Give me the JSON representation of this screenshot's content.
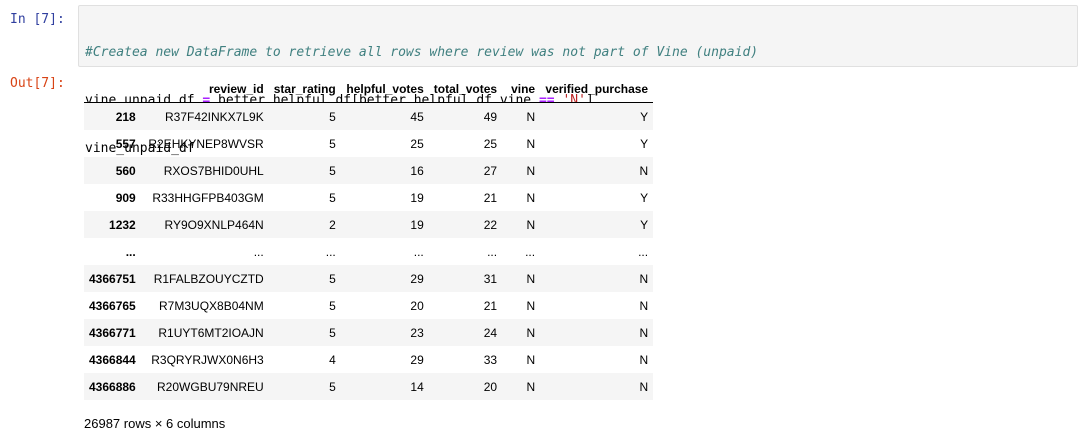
{
  "input_prompt": "In [7]:",
  "output_prompt": "Out[7]:",
  "code": {
    "line1": "#Createa new DataFrame to retrieve all rows where review was not part of Vine (unpaid)",
    "line2": {
      "a": "vine_unpaid_df ",
      "eq": "=",
      "b": " better_helpful_df[better_helpful_df.vine ",
      "op": "==",
      "c": " ",
      "str": "'N'",
      "d": "]"
    },
    "line3": "vine_unpaid_df"
  },
  "dataframe": {
    "columns": [
      "",
      "review_id",
      "star_rating",
      "helpful_votes",
      "total_votes",
      "vine",
      "verified_purchase"
    ],
    "rows": [
      [
        "218",
        "R37F42INKX7L9K",
        "5",
        "45",
        "49",
        "N",
        "Y"
      ],
      [
        "557",
        "R2EHKYNEP8WVSR",
        "5",
        "25",
        "25",
        "N",
        "Y"
      ],
      [
        "560",
        "RXOS7BHID0UHL",
        "5",
        "16",
        "27",
        "N",
        "N"
      ],
      [
        "909",
        "R33HHGFPB403GM",
        "5",
        "19",
        "21",
        "N",
        "Y"
      ],
      [
        "1232",
        "RY9O9XNLP464N",
        "2",
        "19",
        "22",
        "N",
        "Y"
      ],
      [
        "...",
        "...",
        "...",
        "...",
        "...",
        "...",
        "..."
      ],
      [
        "4366751",
        "R1FALBZOUYCZTD",
        "5",
        "29",
        "31",
        "N",
        "N"
      ],
      [
        "4366765",
        "R7M3UQX8B04NM",
        "5",
        "20",
        "21",
        "N",
        "N"
      ],
      [
        "4366771",
        "R1UYT6MT2IOAJN",
        "5",
        "23",
        "24",
        "N",
        "N"
      ],
      [
        "4366844",
        "R3QRYRJWX0N6H3",
        "4",
        "29",
        "33",
        "N",
        "N"
      ],
      [
        "4366886",
        "R20WGBU79NREU",
        "5",
        "14",
        "20",
        "N",
        "N"
      ]
    ]
  },
  "shape_note": "26987 rows × 6 columns"
}
